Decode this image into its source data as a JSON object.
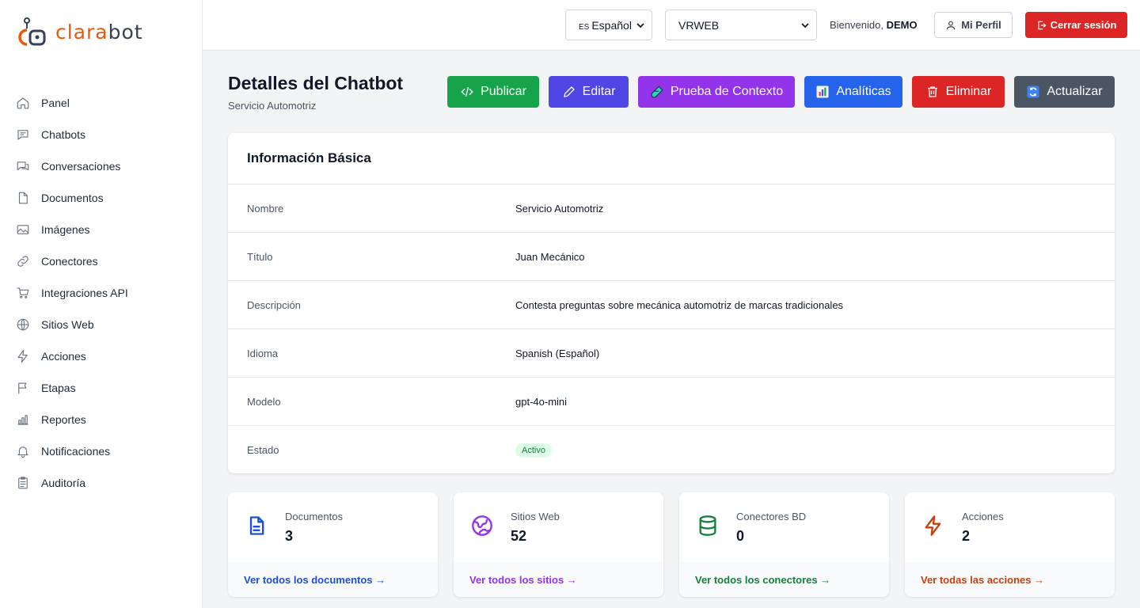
{
  "brand": {
    "part1": "clara",
    "part2": "bot"
  },
  "sidebar": {
    "items": [
      {
        "label": "Panel",
        "icon": "home-icon"
      },
      {
        "label": "Chatbots",
        "icon": "chat-icon"
      },
      {
        "label": "Conversaciones",
        "icon": "conversations-icon"
      },
      {
        "label": "Documentos",
        "icon": "document-icon"
      },
      {
        "label": "Imágenes",
        "icon": "image-icon"
      },
      {
        "label": "Conectores",
        "icon": "link-icon"
      },
      {
        "label": "Integraciones API",
        "icon": "cart-icon"
      },
      {
        "label": "Sitios Web",
        "icon": "globe-icon"
      },
      {
        "label": "Acciones",
        "icon": "bolt-icon"
      },
      {
        "label": "Etapas",
        "icon": "flag-icon"
      },
      {
        "label": "Reportes",
        "icon": "bar-chart-icon"
      },
      {
        "label": "Notificaciones",
        "icon": "bell-icon"
      },
      {
        "label": "Auditoría",
        "icon": "clipboard-icon"
      }
    ]
  },
  "header": {
    "language": {
      "prefix": "ES",
      "value": "Español"
    },
    "organization": "VRWEB",
    "welcome_prefix": "Bienvenido,",
    "welcome_user": "DEMO",
    "profile_label": "Mi Perfil",
    "logout_label": "Cerrar sesión"
  },
  "page": {
    "title": "Detalles del Chatbot",
    "subtitle": "Servicio Automotriz"
  },
  "actions": {
    "publish": "Publicar",
    "edit": "Editar",
    "test": "Prueba de Contexto",
    "analytics": "Analíticas",
    "delete": "Eliminar",
    "refresh": "Actualizar"
  },
  "info": {
    "title": "Información Básica",
    "rows": [
      {
        "label": "Nombre",
        "value": "Servicio Automotriz"
      },
      {
        "label": "Título",
        "value": "Juan Mecánico"
      },
      {
        "label": "Descripción",
        "value": "Contesta preguntas sobre mecánica automotriz de marcas tradicionales"
      },
      {
        "label": "Idioma",
        "value": "Spanish (Español)"
      },
      {
        "label": "Modelo",
        "value": "gpt-4o-mini"
      },
      {
        "label": "Estado",
        "value": "Activo"
      }
    ]
  },
  "stats": [
    {
      "label": "Documentos",
      "value": "3",
      "link": "Ver todos los documentos →",
      "color": "#1d4ed8",
      "icon": "document-icon"
    },
    {
      "label": "Sitios Web",
      "value": "52",
      "link": "Ver todos los sitios →",
      "color": "#9333ea",
      "icon": "globe-icon"
    },
    {
      "label": "Conectores BD",
      "value": "0",
      "link": "Ver todos los conectores →",
      "color": "#15803d",
      "icon": "database-icon"
    },
    {
      "label": "Acciones",
      "value": "2",
      "link": "Ver todas las acciones →",
      "color": "#c2410c",
      "icon": "bolt-icon"
    }
  ],
  "colors": {
    "brand": "#ea580c",
    "publish": "#16a34a",
    "edit": "#4f46e5",
    "test": "#9333ea",
    "analytics": "#2563eb",
    "delete": "#dc2626",
    "refresh": "#4b5563"
  }
}
